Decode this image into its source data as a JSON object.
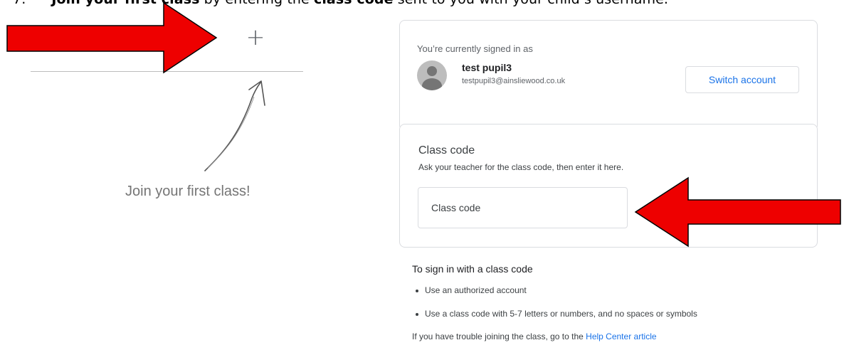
{
  "instruction": {
    "number": "7.",
    "bold_1": "Join your first class",
    "text_1": " by entering the ",
    "bold_2": "class code",
    "text_2": " sent to you with your child’s username."
  },
  "left_panel": {
    "plus_icon": "+",
    "join_text": "Join your first class!"
  },
  "account_card": {
    "label": "You’re currently signed in as",
    "user_name": "test pupil3",
    "user_email": "testpupil3@ainsliewood.co.uk",
    "switch_button": "Switch account"
  },
  "class_code_card": {
    "title": "Class code",
    "subtitle": "Ask your teacher for the class code, then enter it here.",
    "input_placeholder": "Class code",
    "input_value": ""
  },
  "help": {
    "title": "To sign in with a class code",
    "items": [
      "Use an authorized account",
      "Use a class code with 5-7 letters or numbers, and no spaces or symbols"
    ],
    "trouble_text": "If you have trouble joining the class, go to the ",
    "link_text": "Help Center article"
  },
  "colors": {
    "annotation_arrow": "#ee0000",
    "link": "#1a73e8",
    "border": "#dadce0"
  },
  "icons": {
    "plus": "plus-icon",
    "avatar": "default-avatar-icon",
    "hand_drawn_arrow": "hand-drawn-arrow-icon"
  }
}
